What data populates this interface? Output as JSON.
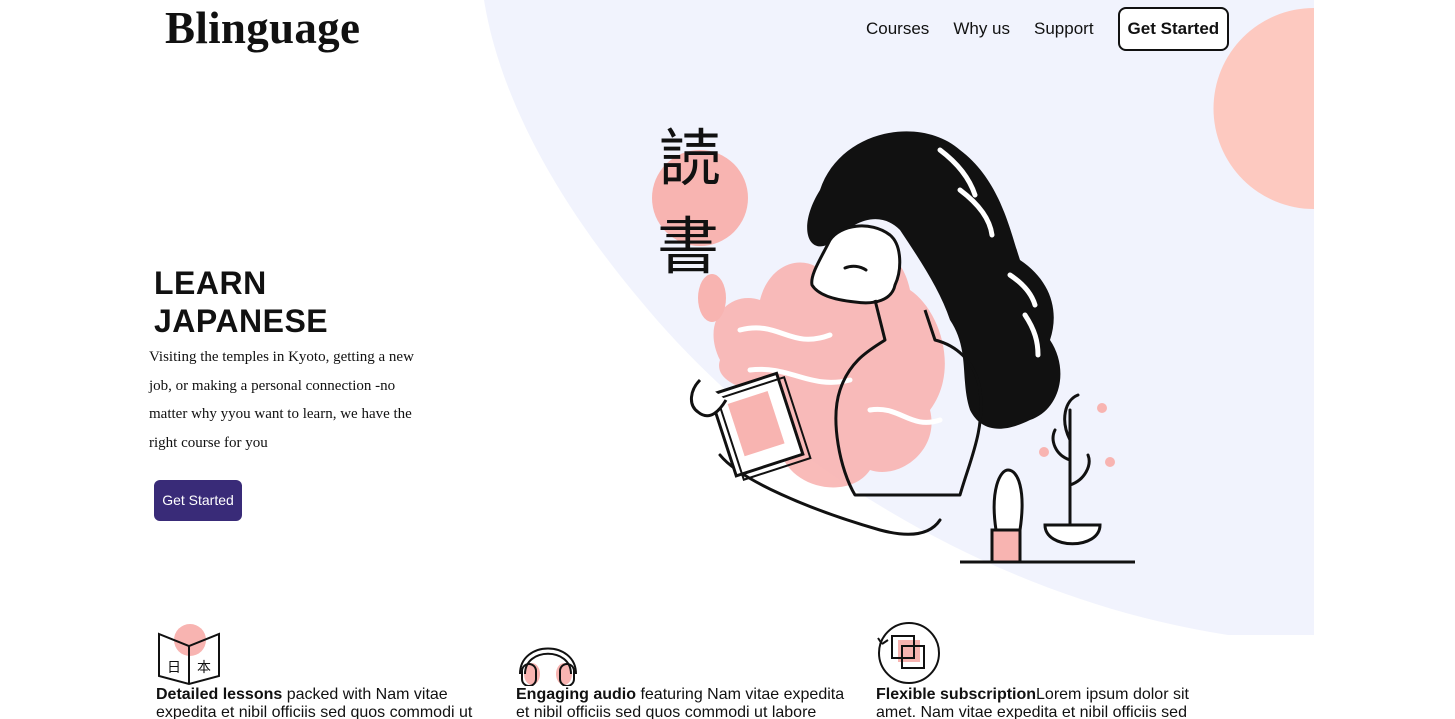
{
  "header": {
    "brand": "Blinguage",
    "nav": [
      {
        "label": "Courses"
      },
      {
        "label": "Why us"
      },
      {
        "label": "Support"
      }
    ],
    "cta_label": "Get Started"
  },
  "hero": {
    "title_line1": "LEARN",
    "title_line2": "JAPANESE",
    "description": "Visiting the temples in Kyoto, getting a new job, or making a personal connection -no matter why yyou want to learn, we have the right course for you",
    "button_label": "Get Started",
    "kanji": [
      "読",
      "書"
    ]
  },
  "features": [
    {
      "title": "Detailed lessons",
      "text": " packed with Nam vitae expedita et nibil officiis sed quos commodi ut",
      "icon": "book-icon"
    },
    {
      "title": "Engaging audio",
      "text": " featuring Nam vitae expedita et nibil officiis sed quos commodi ut labore",
      "icon": "headphones-icon"
    },
    {
      "title": "Flexible subscription",
      "text": "Lorem ipsum dolor sit amet. Nam vitae expedita et nibil officiis sed",
      "icon": "subscription-icon"
    }
  ],
  "colors": {
    "accent": "#392b78",
    "blob_bg": "#f1f3fd",
    "peach": "#fdc9c0",
    "pink": "#f8b4b1"
  }
}
